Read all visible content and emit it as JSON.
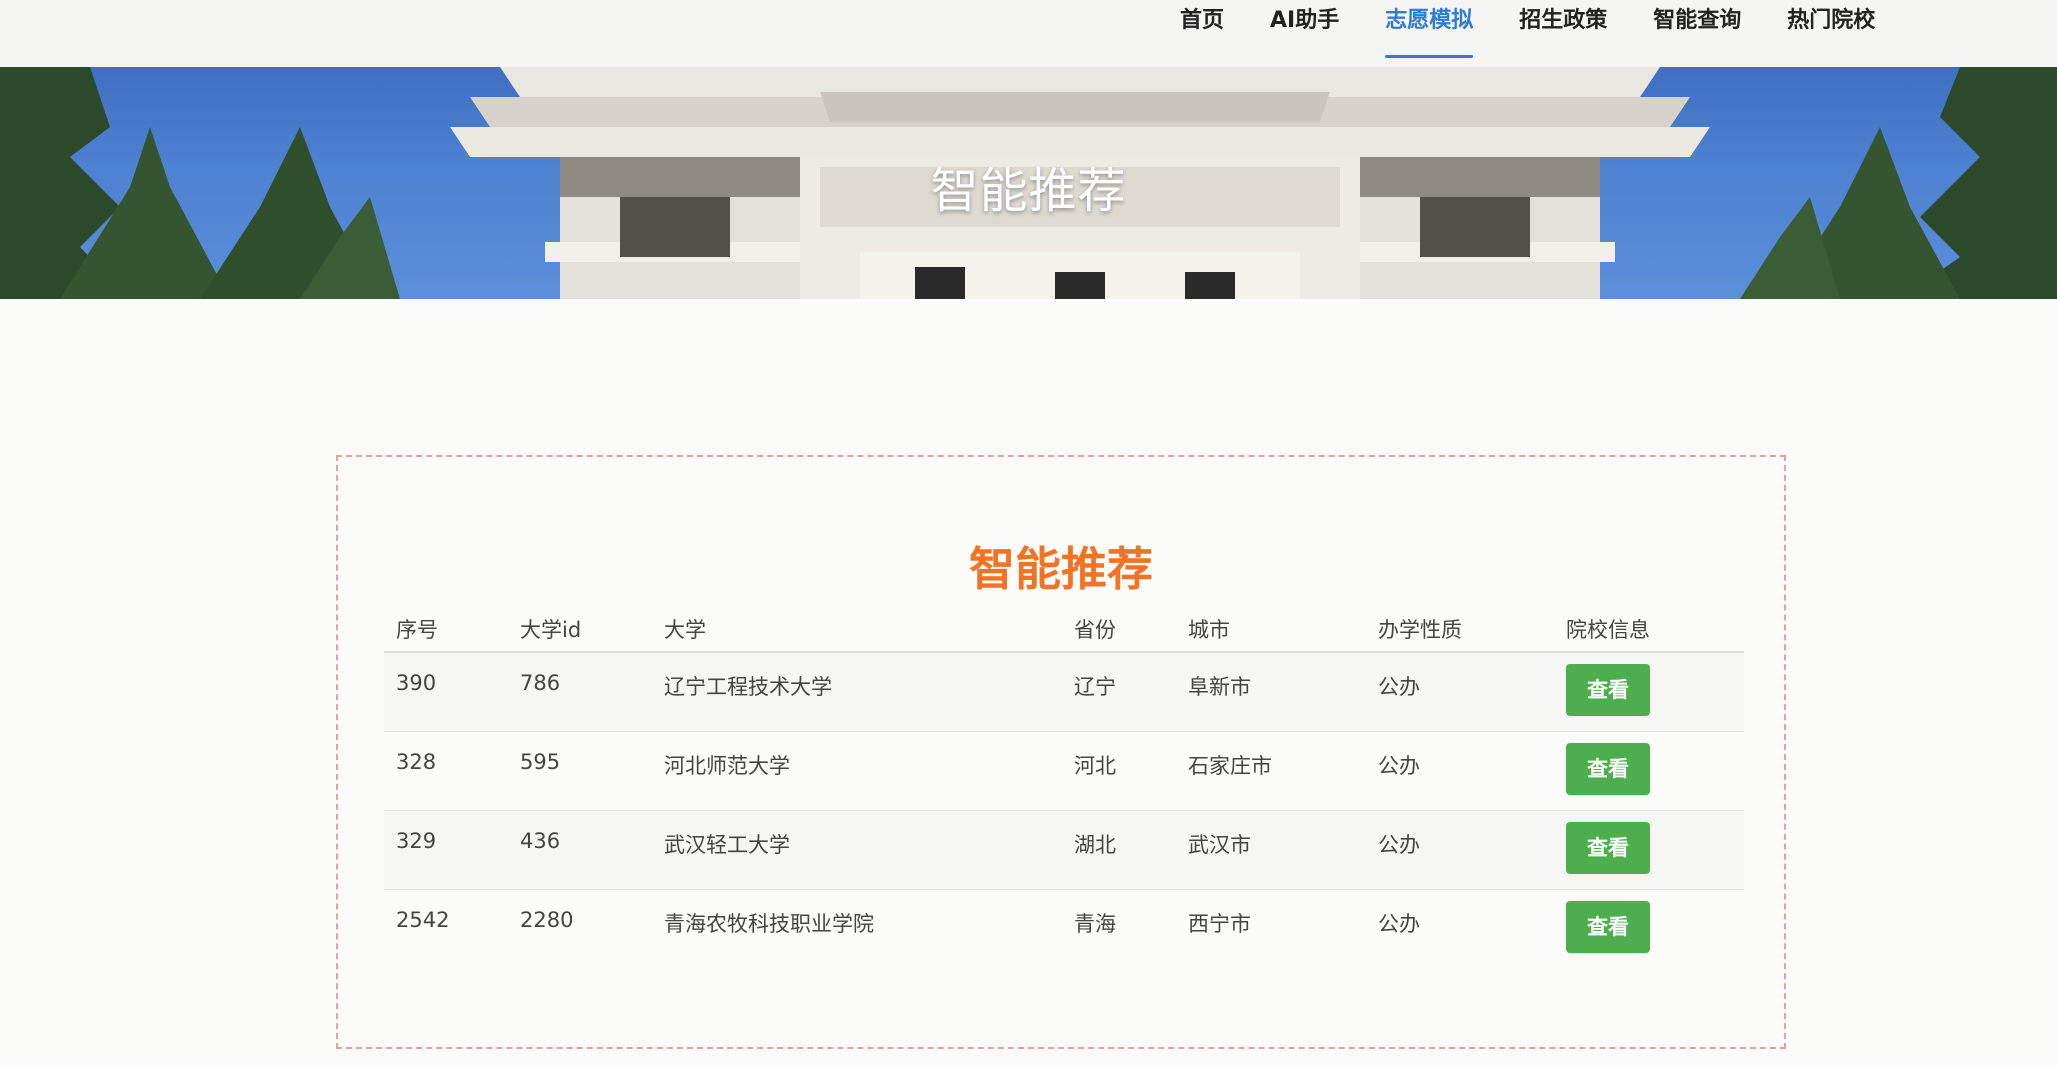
{
  "nav": {
    "items": [
      {
        "label": "首页"
      },
      {
        "label": "AI助手"
      },
      {
        "label": "志愿模拟"
      },
      {
        "label": "招生政策"
      },
      {
        "label": "智能查询"
      },
      {
        "label": "热门院校"
      }
    ],
    "active_index": 2,
    "accent_color": "#2f7bd6"
  },
  "banner": {
    "title": "智能推荐"
  },
  "main": {
    "title": "智能推荐",
    "title_color": "#f27323",
    "table": {
      "columns": [
        "序号",
        "大学id",
        "大学",
        "省份",
        "城市",
        "办学性质",
        "院校信息"
      ],
      "rows": [
        {
          "seq": "390",
          "id": "786",
          "name": "辽宁工程技术大学",
          "province": "辽宁",
          "city": "阜新市",
          "nature": "公办",
          "action": "查看"
        },
        {
          "seq": "328",
          "id": "595",
          "name": "河北师范大学",
          "province": "河北",
          "city": "石家庄市",
          "nature": "公办",
          "action": "查看"
        },
        {
          "seq": "329",
          "id": "436",
          "name": "武汉轻工大学",
          "province": "湖北",
          "city": "武汉市",
          "nature": "公办",
          "action": "查看"
        },
        {
          "seq": "2542",
          "id": "2280",
          "name": "青海农牧科技职业学院",
          "province": "青海",
          "city": "西宁市",
          "nature": "公办",
          "action": "查看"
        }
      ],
      "button_color": "#4cae4c"
    }
  }
}
